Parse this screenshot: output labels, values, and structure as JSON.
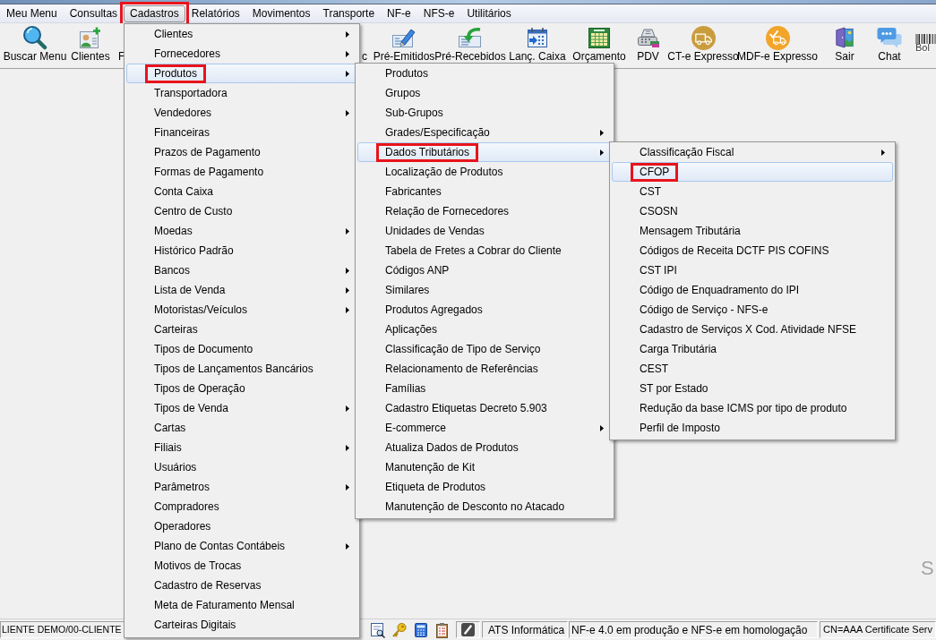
{
  "menu_bar": [
    {
      "label": "Meu Menu",
      "selected": false,
      "annotated": false
    },
    {
      "label": "Consultas",
      "selected": false,
      "annotated": false
    },
    {
      "label": "Cadastros",
      "selected": true,
      "annotated": true
    },
    {
      "label": "Relatórios",
      "selected": false,
      "annotated": false
    },
    {
      "label": "Movimentos",
      "selected": false,
      "annotated": false
    },
    {
      "label": "Transporte",
      "selected": false,
      "annotated": false
    },
    {
      "label": "NF-e",
      "selected": false,
      "annotated": false
    },
    {
      "label": "NFS-e",
      "selected": false,
      "annotated": false
    },
    {
      "label": "Utilitários",
      "selected": false,
      "annotated": false
    }
  ],
  "toolbar": [
    {
      "kind": "icon_button",
      "label": "Buscar Menu"
    },
    {
      "kind": "icon_button",
      "label": "Clientes"
    },
    {
      "kind": "label_only",
      "label": "F"
    },
    {
      "kind": "label_only",
      "label": "c"
    },
    {
      "kind": "icon_button",
      "label": "Pré-Emitidos"
    },
    {
      "kind": "icon_button",
      "label": "Pré-Recebidos"
    },
    {
      "kind": "icon_button",
      "label": "Lanç. Caixa"
    },
    {
      "kind": "icon_button",
      "label": "Orçamento"
    },
    {
      "kind": "icon_button",
      "label": "PDV"
    },
    {
      "kind": "icon_button",
      "label": "CT-e Expresso"
    },
    {
      "kind": "icon_button",
      "label": "MDF-e Expresso"
    },
    {
      "kind": "icon_button",
      "label": "Sair"
    },
    {
      "kind": "icon_button",
      "label": "Chat"
    },
    {
      "kind": "barcode",
      "label": "Bol"
    }
  ],
  "workspace": {
    "logo_text": "S"
  },
  "menus": [
    {
      "items": [
        {
          "label": "Clientes",
          "submenu": true,
          "selected": false,
          "annotated": false
        },
        {
          "label": "Fornecedores",
          "submenu": true,
          "selected": false,
          "annotated": false
        },
        {
          "label": "Produtos",
          "submenu": true,
          "selected": true,
          "annotated": true
        },
        {
          "label": "Transportadora",
          "submenu": false,
          "selected": false,
          "annotated": false
        },
        {
          "label": "Vendedores",
          "submenu": true,
          "selected": false,
          "annotated": false
        },
        {
          "label": "Financeiras",
          "submenu": false,
          "selected": false,
          "annotated": false
        },
        {
          "label": "Prazos de Pagamento",
          "submenu": false,
          "selected": false,
          "annotated": false
        },
        {
          "label": "Formas de Pagamento",
          "submenu": false,
          "selected": false,
          "annotated": false
        },
        {
          "label": "Conta Caixa",
          "submenu": false,
          "selected": false,
          "annotated": false
        },
        {
          "label": "Centro de Custo",
          "submenu": false,
          "selected": false,
          "annotated": false
        },
        {
          "label": "Moedas",
          "submenu": true,
          "selected": false,
          "annotated": false
        },
        {
          "label": "Histórico Padrão",
          "submenu": false,
          "selected": false,
          "annotated": false
        },
        {
          "label": "Bancos",
          "submenu": true,
          "selected": false,
          "annotated": false
        },
        {
          "label": "Lista de Venda",
          "submenu": true,
          "selected": false,
          "annotated": false
        },
        {
          "label": "Motoristas/Veículos",
          "submenu": true,
          "selected": false,
          "annotated": false
        },
        {
          "label": "Carteiras",
          "submenu": false,
          "selected": false,
          "annotated": false
        },
        {
          "label": "Tipos de Documento",
          "submenu": false,
          "selected": false,
          "annotated": false
        },
        {
          "label": "Tipos de Lançamentos Bancários",
          "submenu": false,
          "selected": false,
          "annotated": false
        },
        {
          "label": "Tipos de Operação",
          "submenu": false,
          "selected": false,
          "annotated": false
        },
        {
          "label": "Tipos de Venda",
          "submenu": true,
          "selected": false,
          "annotated": false
        },
        {
          "label": "Cartas",
          "submenu": false,
          "selected": false,
          "annotated": false
        },
        {
          "label": "Filiais",
          "submenu": true,
          "selected": false,
          "annotated": false
        },
        {
          "label": "Usuários",
          "submenu": false,
          "selected": false,
          "annotated": false
        },
        {
          "label": "Parâmetros",
          "submenu": true,
          "selected": false,
          "annotated": false
        },
        {
          "label": "Compradores",
          "submenu": false,
          "selected": false,
          "annotated": false
        },
        {
          "label": "Operadores",
          "submenu": false,
          "selected": false,
          "annotated": false
        },
        {
          "label": "Plano de Contas Contábeis",
          "submenu": true,
          "selected": false,
          "annotated": false
        },
        {
          "label": "Motivos de Trocas",
          "submenu": false,
          "selected": false,
          "annotated": false
        },
        {
          "label": "Cadastro de Reservas",
          "submenu": false,
          "selected": false,
          "annotated": false
        },
        {
          "label": "Meta de Faturamento Mensal",
          "submenu": false,
          "selected": false,
          "annotated": false
        },
        {
          "label": "Carteiras Digitais",
          "submenu": false,
          "selected": false,
          "annotated": false
        }
      ]
    },
    {
      "items": [
        {
          "label": "Produtos",
          "submenu": false,
          "selected": false,
          "annotated": false
        },
        {
          "label": "Grupos",
          "submenu": false,
          "selected": false,
          "annotated": false
        },
        {
          "label": "Sub-Grupos",
          "submenu": false,
          "selected": false,
          "annotated": false
        },
        {
          "label": "Grades/Especificação",
          "submenu": true,
          "selected": false,
          "annotated": false
        },
        {
          "label": "Dados Tributários",
          "submenu": true,
          "selected": true,
          "annotated": true
        },
        {
          "label": "Localização de Produtos",
          "submenu": false,
          "selected": false,
          "annotated": false
        },
        {
          "label": "Fabricantes",
          "submenu": false,
          "selected": false,
          "annotated": false
        },
        {
          "label": "Relação de Fornecedores",
          "submenu": false,
          "selected": false,
          "annotated": false
        },
        {
          "label": "Unidades de Vendas",
          "submenu": false,
          "selected": false,
          "annotated": false
        },
        {
          "label": "Tabela de Fretes a Cobrar do Cliente",
          "submenu": false,
          "selected": false,
          "annotated": false
        },
        {
          "label": "Códigos ANP",
          "submenu": false,
          "selected": false,
          "annotated": false
        },
        {
          "label": "Similares",
          "submenu": false,
          "selected": false,
          "annotated": false
        },
        {
          "label": "Produtos Agregados",
          "submenu": false,
          "selected": false,
          "annotated": false
        },
        {
          "label": "Aplicações",
          "submenu": false,
          "selected": false,
          "annotated": false
        },
        {
          "label": "Classificação de Tipo de Serviço",
          "submenu": false,
          "selected": false,
          "annotated": false
        },
        {
          "label": "Relacionamento de Referências",
          "submenu": false,
          "selected": false,
          "annotated": false
        },
        {
          "label": "Famílias",
          "submenu": false,
          "selected": false,
          "annotated": false
        },
        {
          "label": "Cadastro Etiquetas Decreto 5.903",
          "submenu": false,
          "selected": false,
          "annotated": false
        },
        {
          "label": "E-commerce",
          "submenu": true,
          "selected": false,
          "annotated": false
        },
        {
          "label": "Atualiza Dados de Produtos",
          "submenu": false,
          "selected": false,
          "annotated": false
        },
        {
          "label": "Manutenção de Kit",
          "submenu": false,
          "selected": false,
          "annotated": false
        },
        {
          "label": "Etiqueta de Produtos",
          "submenu": false,
          "selected": false,
          "annotated": false
        },
        {
          "label": "Manutenção de Desconto no Atacado",
          "submenu": false,
          "selected": false,
          "annotated": false
        }
      ]
    },
    {
      "items": [
        {
          "label": "Classificação Fiscal",
          "submenu": true,
          "selected": false,
          "annotated": false
        },
        {
          "label": "CFOP",
          "submenu": false,
          "selected": true,
          "annotated": true
        },
        {
          "label": "CST",
          "submenu": false,
          "selected": false,
          "annotated": false
        },
        {
          "label": "CSOSN",
          "submenu": false,
          "selected": false,
          "annotated": false
        },
        {
          "label": "Mensagem Tributária",
          "submenu": false,
          "selected": false,
          "annotated": false
        },
        {
          "label": "Códigos de Receita DCTF PIS COFINS",
          "submenu": false,
          "selected": false,
          "annotated": false
        },
        {
          "label": "CST IPI",
          "submenu": false,
          "selected": false,
          "annotated": false
        },
        {
          "label": "Código de Enquadramento do IPI",
          "submenu": false,
          "selected": false,
          "annotated": false
        },
        {
          "label": "Código de Serviço - NFS-e",
          "submenu": false,
          "selected": false,
          "annotated": false
        },
        {
          "label": "Cadastro de Serviços X Cod. Atividade NFSE",
          "submenu": false,
          "selected": false,
          "annotated": false
        },
        {
          "label": "Carga Tributária",
          "submenu": false,
          "selected": false,
          "annotated": false
        },
        {
          "label": "CEST",
          "submenu": false,
          "selected": false,
          "annotated": false
        },
        {
          "label": "ST por Estado",
          "submenu": false,
          "selected": false,
          "annotated": false
        },
        {
          "label": "Redução da base ICMS por tipo de produto",
          "submenu": false,
          "selected": false,
          "annotated": false
        },
        {
          "label": "Perfil de Imposto",
          "submenu": false,
          "selected": false,
          "annotated": false
        }
      ]
    }
  ],
  "status_bar": {
    "panels": [
      "LIENTE DEMO/00-CLIENTE",
      "ATS Informática",
      "NF-e 4.0 em produção e NFS-e em homologação",
      "CN=AAA Certificate Serv"
    ]
  }
}
